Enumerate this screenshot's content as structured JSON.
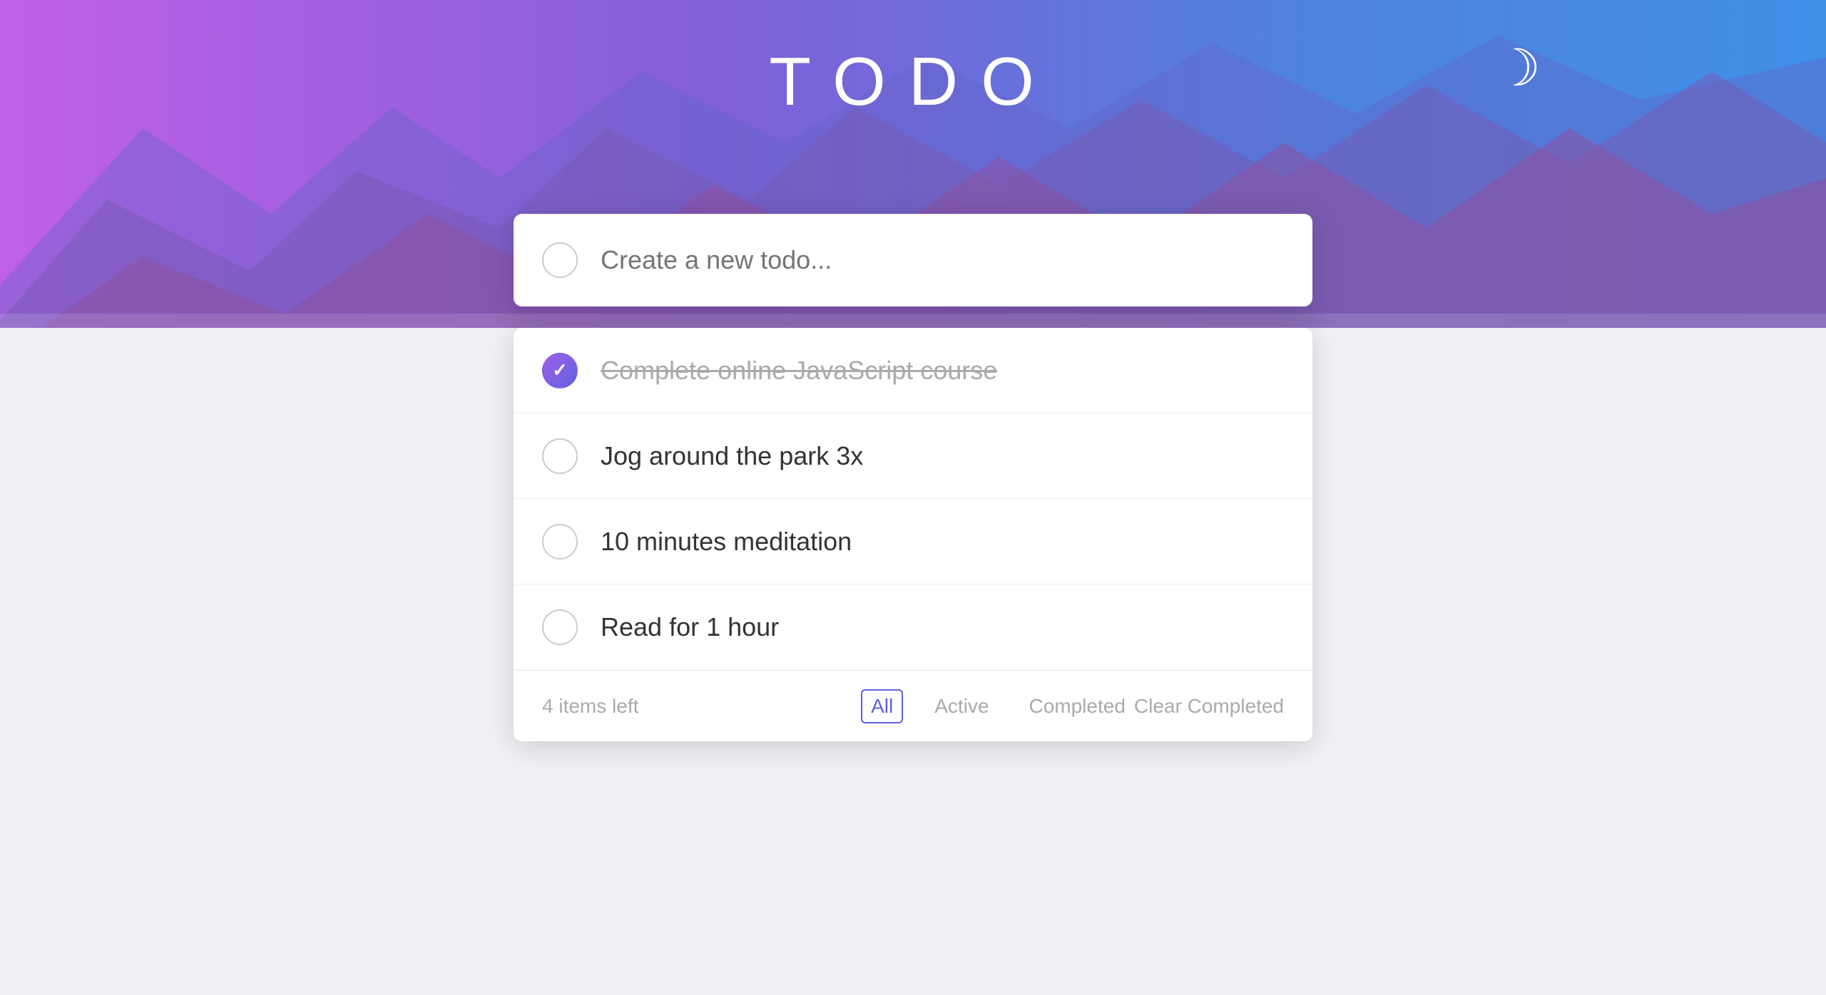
{
  "app": {
    "title": "TODO",
    "darkmode_icon": "☽"
  },
  "new_todo": {
    "placeholder": "Create a new todo..."
  },
  "todos": [
    {
      "id": 1,
      "text": "Complete online JavaScript course",
      "completed": true
    },
    {
      "id": 2,
      "text": "Jog around the park 3x",
      "completed": false
    },
    {
      "id": 3,
      "text": "10 minutes meditation",
      "completed": false
    },
    {
      "id": 4,
      "text": "Read for 1 hour",
      "completed": false
    }
  ],
  "footer": {
    "items_left": "4 items left",
    "filters": [
      "All",
      "Active",
      "Completed"
    ],
    "active_filter": "All",
    "clear_label": "Clear Completed"
  }
}
